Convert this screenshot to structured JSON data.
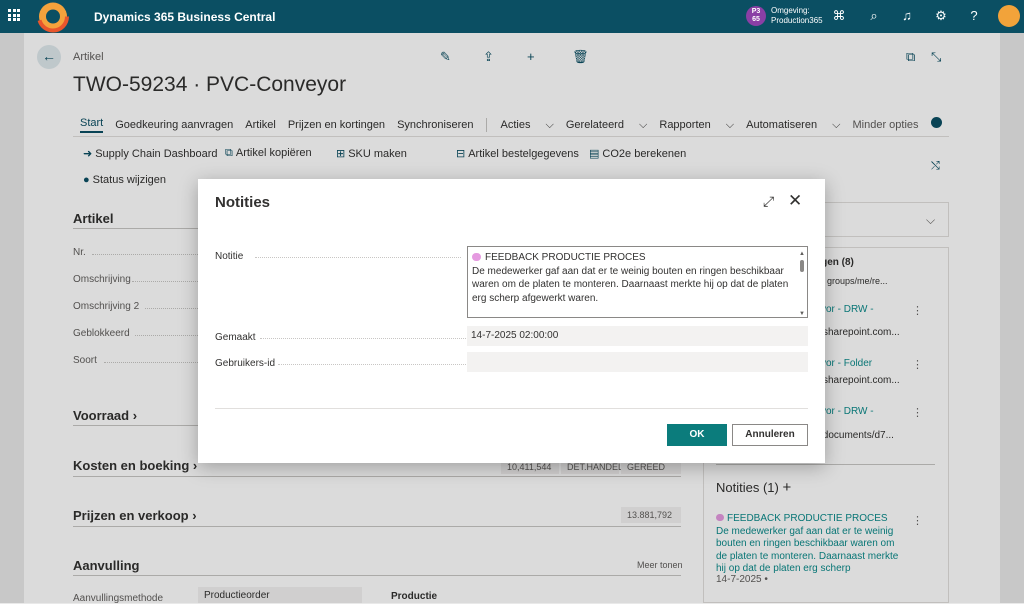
{
  "app": {
    "title": "Dynamics 365 Business Central",
    "env_badge": "P3\n65",
    "env_label": "Omgeving:",
    "env_name": "Production365"
  },
  "page": {
    "breadcrumb": "Artikel",
    "title": "TWO-59234 · PVC-Conveyor"
  },
  "tabs": [
    "Start",
    "Goedkeuring aanvragen",
    "Artikel",
    "Prijzen en kortingen",
    "Synchroniseren",
    "Acties",
    "Gerelateerd",
    "Rapporten",
    "Automatiseren",
    "Minder opties"
  ],
  "promoted": {
    "row1": [
      "Supply Chain Dashboard",
      "Artikel kopiëren",
      "SKU maken",
      "Artikel bestelgegevens",
      "CO2e berekenen"
    ],
    "row2": [
      "Status wijzigen"
    ]
  },
  "sections": {
    "artikel": "Artikel",
    "artikel_fields": [
      "Nr.",
      "Omschrijving",
      "Omschrijving 2",
      "Geblokkeerd",
      "Soort"
    ],
    "voorraad": "Voorraad",
    "kosten": "Kosten en boeking",
    "kosten_values": [
      "10,411,544",
      "DET.HANDEL",
      "GEREED"
    ],
    "prijzen": "Prijzen en verkoop",
    "prijzen_value": "13.881,792",
    "aanvulling": "Aanvulling",
    "meer_tonen": "Meer tonen",
    "aanvulling_field": "Aanvullingsmethode",
    "aanvulling_value": "Productieorder",
    "productie": "Productie"
  },
  "factbox": {
    "links_header": "ngen (8)",
    "links_url": "groups/me/re...",
    "items": [
      {
        "title": "vor - DRW -",
        "sub": "sharepoint.com..."
      },
      {
        "title": "vor - Folder",
        "sub": "sharepoint.com..."
      },
      {
        "title": "vor - DRW -",
        "sub": "/documents/d7..."
      }
    ],
    "notes_header": "Notities (1)",
    "note_title": "FEEDBACK PRODUCTIE PROCES",
    "note_body": "De medewerker gaf aan dat er te weinig bouten en ringen beschikbaar waren om de platen te monteren. Daarnaast merkte hij op dat de platen erg scherp",
    "note_date": "14-7-2025 •"
  },
  "dialog": {
    "title": "Notities",
    "lbl_note": "Notitie",
    "note_title": "FEEDBACK PRODUCTIE PROCES",
    "note_body": "De medewerker gaf aan dat er te weinig bouten en ringen beschikbaar waren om de platen te monteren. Daarnaast merkte hij op dat de platen erg scherp afgewerkt waren.",
    "lbl_created": "Gemaakt",
    "created": "14-7-2025 02:00:00",
    "lbl_user": "Gebruikers-id",
    "user": "",
    "ok": "OK",
    "cancel": "Annuleren"
  },
  "colors": {
    "topbar": "#0b4f63",
    "accent": "#0b7c7c",
    "link": "#0b8a8a"
  }
}
